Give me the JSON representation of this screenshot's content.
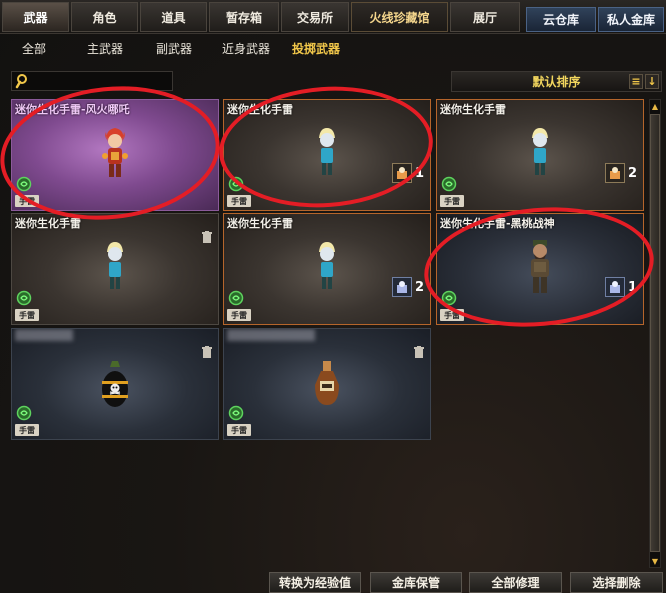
{
  "tabs": [
    {
      "label": "武器"
    },
    {
      "label": "角色"
    },
    {
      "label": "道具"
    },
    {
      "label": "暂存箱"
    },
    {
      "label": "交易所"
    },
    {
      "label": "火线珍藏馆"
    },
    {
      "label": "展厅"
    },
    {
      "label": "云仓库"
    },
    {
      "label": "私人金库"
    }
  ],
  "subtabs": [
    {
      "label": "全部"
    },
    {
      "label": "主武器"
    },
    {
      "label": "副武器"
    },
    {
      "label": "近身武器"
    },
    {
      "label": "投掷武器"
    }
  ],
  "search": {
    "placeholder": "",
    "icon": "search-icon"
  },
  "sort": {
    "label": "默认排序"
  },
  "items": [
    {
      "title": "迷你生化手雷-风火哪吒",
      "tag": "手雷",
      "count": ""
    },
    {
      "title": "迷你生化手雷",
      "tag": "手雷",
      "count": "1"
    },
    {
      "title": "迷你生化手雷",
      "tag": "手雷",
      "count": "2"
    },
    {
      "title": "迷你生化手雷",
      "tag": "手雷",
      "count": ""
    },
    {
      "title": "迷你生化手雷",
      "tag": "手雷",
      "count": "2"
    },
    {
      "title": "迷你生化手雷-黑桃战神",
      "tag": "手雷",
      "count": "1"
    },
    {
      "title": "",
      "tag": "手雷",
      "count": ""
    },
    {
      "title": "",
      "tag": "手雷",
      "count": ""
    }
  ],
  "buttons": {
    "convert": "转换为经验值",
    "vault": "金库保管",
    "repair": "全部修理",
    "delete": "选择删除"
  },
  "colors": {
    "accent": "#f2c84a",
    "annotation": "#e41d25"
  }
}
